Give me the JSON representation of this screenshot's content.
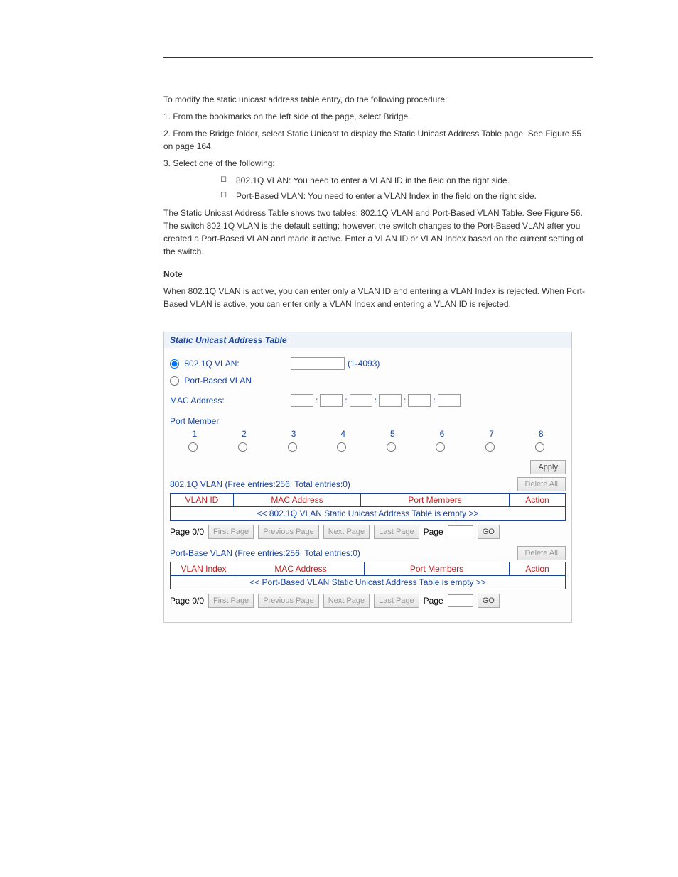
{
  "doc": {
    "p1": "To modify the static unicast address table entry, do the following procedure:",
    "p2": "1. From the bookmarks on the left side of the page, select Bridge.",
    "p3": "2. From the Bridge folder, select Static Unicast to display the Static Unicast Address Table page. See Figure 55 on page 164.",
    "p4": "3. Select one of the following:",
    "b1": "802.1Q VLAN: You need to enter a VLAN ID in the field on the right side.",
    "b2": "Port-Based VLAN: You need to enter a VLAN Index in the field on the right side.",
    "p5": "The Static Unicast Address Table shows two tables: 802.1Q VLAN and Port-Based VLAN Table. See Figure 56. The switch 802.1Q VLAN is the default setting; however, the switch changes to the Port-Based VLAN after you created a Port-Based VLAN and made it active. Enter a VLAN ID or VLAN Index based on the current setting of the switch.",
    "note": "Note",
    "note_body": "When 802.1Q VLAN is active, you can enter only a VLAN ID and entering a VLAN Index is rejected. When Port-Based VLAN is active, you can enter only a VLAN Index and entering a VLAN ID is rejected."
  },
  "panel": {
    "title": "Static Unicast Address Table",
    "vlan8021q_label": "802.1Q VLAN:",
    "vlanPortBased_label": "Port-Based VLAN",
    "vlan_range": "(1-4093)",
    "mac_label": "MAC Address:",
    "port_member_title": "Port Member",
    "ports": [
      "1",
      "2",
      "3",
      "4",
      "5",
      "6",
      "7",
      "8"
    ],
    "apply_btn": "Apply",
    "delete_all_btn": "Delete All",
    "section1_label": "802.1Q VLAN (Free entries:256, Total entries:0)",
    "table1_cols": {
      "c1": "VLAN ID",
      "c2": "MAC Address",
      "c3": "Port Members",
      "c4": "Action"
    },
    "table1_empty": "<< 802.1Q VLAN Static Unicast Address Table is empty >>",
    "section2_label": "Port-Base VLAN (Free entries:256, Total entries:0)",
    "table2_cols": {
      "c1": "VLAN Index",
      "c2": "MAC Address",
      "c3": "Port Members",
      "c4": "Action"
    },
    "table2_empty": "<< Port-Based VLAN Static Unicast Address Table is empty >>",
    "pager": {
      "page_label": "Page 0/0",
      "first": "First Page",
      "prev": "Previous Page",
      "next": "Next Page",
      "last": "Last Page",
      "page_word": "Page",
      "go": "GO"
    }
  }
}
